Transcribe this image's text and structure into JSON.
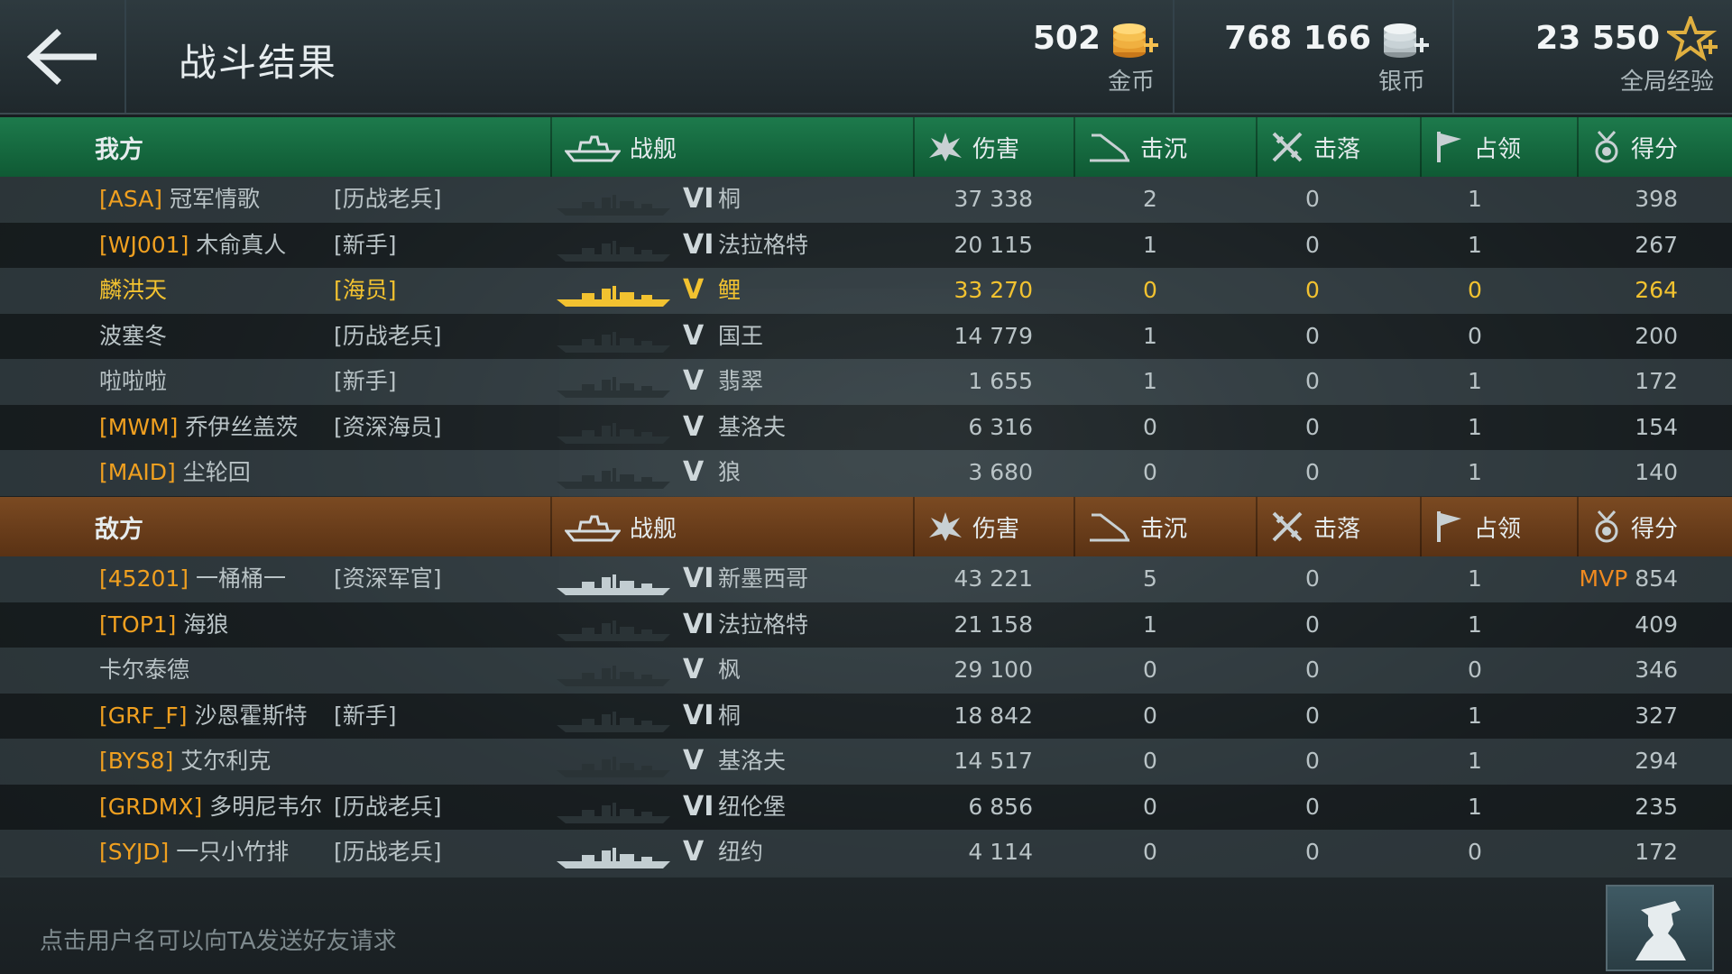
{
  "header": {
    "title": "战斗结果",
    "back_icon": "arrow-left-icon",
    "currencies": [
      {
        "amount": "502",
        "label": "金币",
        "icon": "gold-coins-add-icon"
      },
      {
        "amount": "768 166",
        "label": "银币",
        "icon": "silver-coins-add-icon"
      },
      {
        "amount": "23 550",
        "label": "全局经验",
        "icon": "star-add-icon"
      }
    ]
  },
  "columns": {
    "ship": "战舰",
    "damage": "伤害",
    "sunk": "击沉",
    "downed": "击落",
    "capture": "占领",
    "score": "得分"
  },
  "ally": {
    "label": "我方",
    "color": "#1d7a4c",
    "players": [
      {
        "clan": "[ASA]",
        "name": "冠军情歌",
        "rank": "[历战老兵]",
        "tier": "VI",
        "ship": "桐",
        "damage": "37 338",
        "sunk": "2",
        "downed": "0",
        "capture": "1",
        "score": "398"
      },
      {
        "clan": "[WJ001]",
        "name": "木俞真人",
        "rank": "[新手]",
        "tier": "VI",
        "ship": "法拉格特",
        "damage": "20 115",
        "sunk": "1",
        "downed": "0",
        "capture": "1",
        "score": "267"
      },
      {
        "clan": "",
        "name": "麟洪天",
        "rank": "[海员]",
        "tier": "V",
        "ship": "鲤",
        "damage": "33 270",
        "sunk": "0",
        "downed": "0",
        "capture": "0",
        "score": "264",
        "self": true
      },
      {
        "clan": "",
        "name": "波塞冬",
        "rank": "[历战老兵]",
        "tier": "V",
        "ship": "国王",
        "damage": "14 779",
        "sunk": "1",
        "downed": "0",
        "capture": "0",
        "score": "200"
      },
      {
        "clan": "",
        "name": "啦啦啦",
        "rank": "[新手]",
        "tier": "V",
        "ship": "翡翠",
        "damage": "1 655",
        "sunk": "1",
        "downed": "0",
        "capture": "1",
        "score": "172"
      },
      {
        "clan": "[MWM]",
        "name": "乔伊丝盖茨",
        "rank": "[资深海员]",
        "tier": "V",
        "ship": "基洛夫",
        "damage": "6 316",
        "sunk": "0",
        "downed": "0",
        "capture": "1",
        "score": "154"
      },
      {
        "clan": "[MAID]",
        "name": "尘轮回",
        "rank": "",
        "tier": "V",
        "ship": "狼",
        "damage": "3 680",
        "sunk": "0",
        "downed": "0",
        "capture": "1",
        "score": "140"
      }
    ]
  },
  "enemy": {
    "label": "敌方",
    "color": "#7b4a22",
    "players": [
      {
        "clan": "[45201]",
        "name": "一桶桶一",
        "rank": "[资深军官]",
        "tier": "VI",
        "ship": "新墨西哥",
        "damage": "43 221",
        "sunk": "5",
        "downed": "0",
        "capture": "1",
        "score": "854",
        "mvp": "MVP"
      },
      {
        "clan": "[TOP1]",
        "name": "海狼",
        "rank": "",
        "tier": "VI",
        "ship": "法拉格特",
        "damage": "21 158",
        "sunk": "1",
        "downed": "0",
        "capture": "1",
        "score": "409"
      },
      {
        "clan": "",
        "name": "卡尔泰德",
        "rank": "",
        "tier": "V",
        "ship": "枫",
        "damage": "29 100",
        "sunk": "0",
        "downed": "0",
        "capture": "0",
        "score": "346"
      },
      {
        "clan": "[GRF_F]",
        "name": "沙恩霍斯特",
        "rank": "[新手]",
        "tier": "VI",
        "ship": "桐",
        "damage": "18 842",
        "sunk": "0",
        "downed": "0",
        "capture": "1",
        "score": "327"
      },
      {
        "clan": "[BYS8]",
        "name": "艾尔利克",
        "rank": "",
        "tier": "V",
        "ship": "基洛夫",
        "damage": "14 517",
        "sunk": "0",
        "downed": "0",
        "capture": "1",
        "score": "294"
      },
      {
        "clan": "[GRDMX]",
        "name": "多明尼韦尔",
        "rank": "[历战老兵]",
        "tier": "VI",
        "ship": "纽伦堡",
        "damage": "6 856",
        "sunk": "0",
        "downed": "0",
        "capture": "1",
        "score": "235"
      },
      {
        "clan": "[SYJD]",
        "name": "一只小竹排",
        "rank": "[历战老兵]",
        "tier": "V",
        "ship": "纽约",
        "damage": "4 114",
        "sunk": "0",
        "downed": "0",
        "capture": "0",
        "score": "172"
      }
    ]
  },
  "footer": {
    "hint": "点击用户名可以向TA发送好友请求",
    "captain_icon": "captain-silhouette-icon"
  }
}
